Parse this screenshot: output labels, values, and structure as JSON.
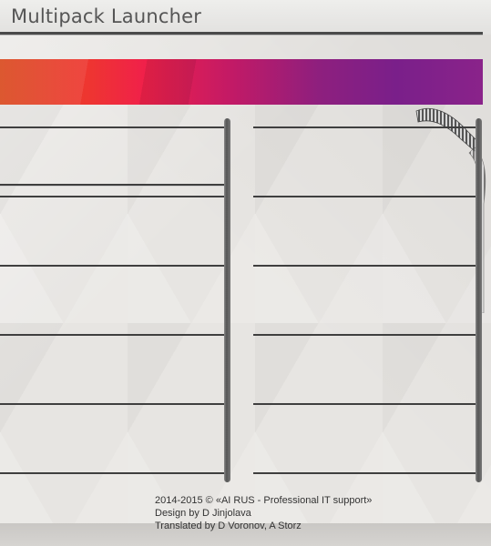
{
  "window": {
    "title": "Multipack Launcher"
  },
  "banner": {
    "colors": [
      "#d94a1f",
      "#ee3630",
      "#f0204a",
      "#c21a66",
      "#8e1f7e",
      "#7a1f8a"
    ]
  },
  "left_column": {
    "slots": [
      "",
      "",
      "",
      "",
      ""
    ]
  },
  "right_column": {
    "slots": [
      "",
      "",
      "",
      "",
      ""
    ]
  },
  "footer": {
    "copyright": "2014-2015 © «AI RUS - Professional IT support»",
    "design": "Design by D Jinjolava",
    "translation": "Translated by D Voronov, A Storz"
  },
  "decor": {
    "cable_icon": "usb-cable-icon"
  }
}
